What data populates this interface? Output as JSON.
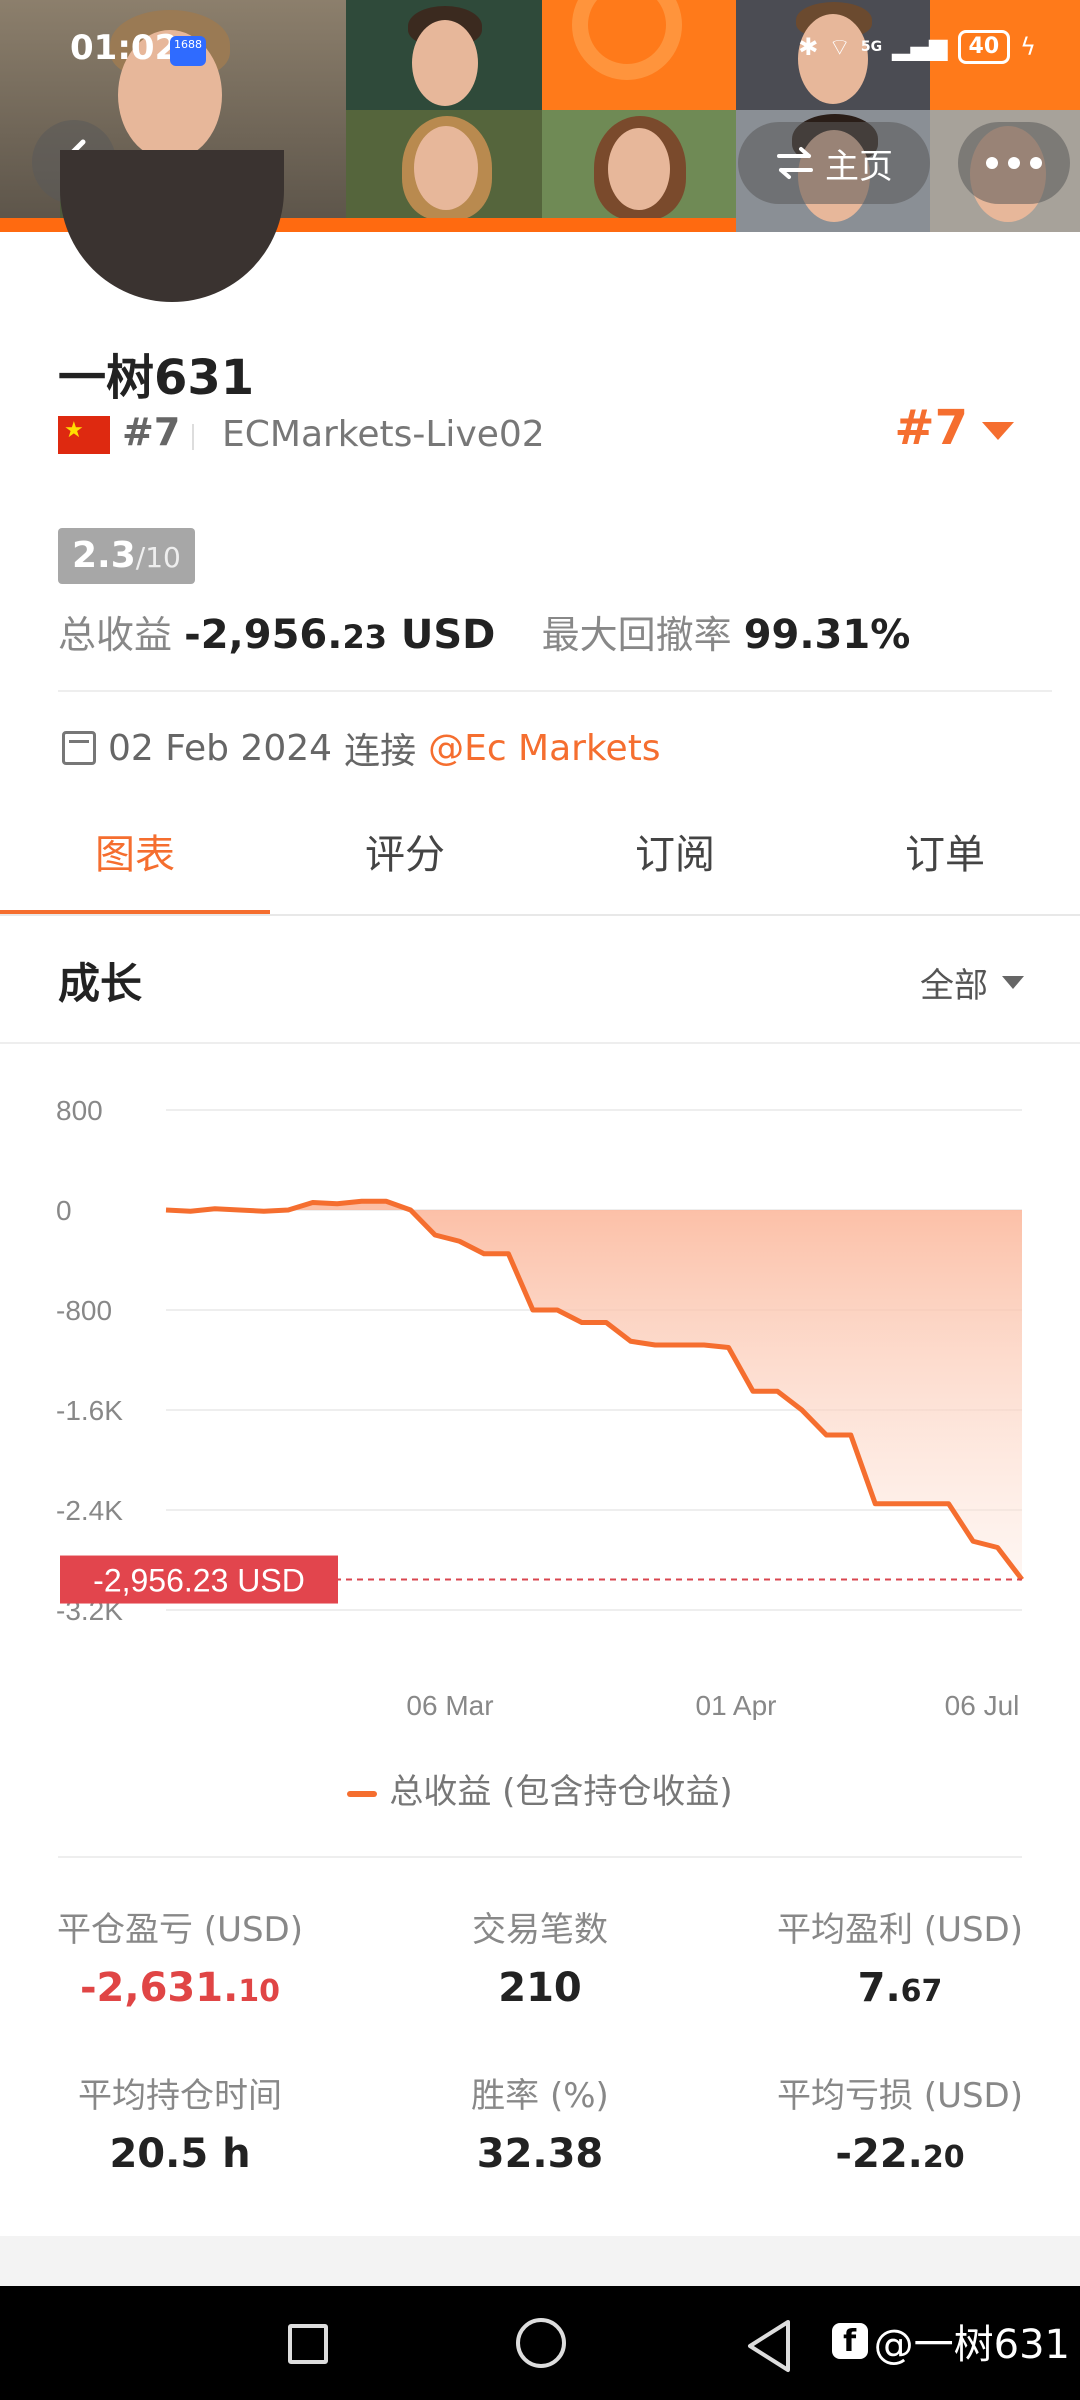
{
  "status_bar": {
    "time": "01:02",
    "app_badge": "1688",
    "signal": "5G",
    "battery": "40"
  },
  "header": {
    "home_label": "主页"
  },
  "profile": {
    "name": "一树631",
    "rank_small": "#7",
    "server": "ECMarkets-Live02",
    "rank_big": "#7",
    "score": "2.3",
    "score_max": "/10",
    "total_profit_label": "总收益",
    "total_profit_main": "-2,956.",
    "total_profit_cents": "23",
    "total_profit_unit": " USD",
    "max_drawdown_label": "最大回撤率",
    "max_drawdown_value": "99.31%",
    "connect_date": "02 Feb 2024",
    "connect_label": "连接",
    "broker": "@Ec Markets"
  },
  "tabs": [
    "图表",
    "评分",
    "订阅",
    "订单"
  ],
  "section": {
    "title": "成长",
    "range": "全部"
  },
  "chart_data": {
    "type": "area",
    "y_tick_labels": [
      "800",
      "0",
      "-800",
      "-1.6K",
      "-2.4K",
      "-3.2K"
    ],
    "y_tick_values": [
      800,
      0,
      -800,
      -1600,
      -2400,
      -3200
    ],
    "x_tick_labels": [
      "06 Mar",
      "01 Apr",
      "06 Jul"
    ],
    "ylim": [
      -3200,
      800
    ],
    "current_value_label": "-2,956.23 USD",
    "current_value": -2956.23,
    "series": [
      {
        "name": "总收益 (包含持仓收益)",
        "y": [
          0,
          -10,
          10,
          0,
          -10,
          0,
          60,
          50,
          70,
          70,
          0,
          -200,
          -250,
          -350,
          -350,
          -800,
          -800,
          -900,
          -900,
          -1050,
          -1080,
          -1080,
          -1080,
          -1100,
          -1450,
          -1450,
          -1600,
          -1800,
          -1800,
          -2350,
          -2350,
          -2350,
          -2350,
          -2650,
          -2700,
          -2956.23
        ]
      }
    ],
    "color": "#f56e2f",
    "fill_color": "#fbb79b",
    "grid": true
  },
  "legend_label": "总收益 (包含持仓收益)",
  "metrics": [
    {
      "label": "平仓盈亏 (USD)",
      "main": "-2,631.",
      "cents": "10",
      "negative": true
    },
    {
      "label": "交易笔数",
      "main": "210",
      "cents": "",
      "negative": false
    },
    {
      "label": "平均盈利 (USD)",
      "main": "7.",
      "cents": "67",
      "negative": false
    },
    {
      "label": "平均持仓时间",
      "main": "20.5 h",
      "cents": "",
      "negative": false
    },
    {
      "label": "胜率 (%)",
      "main": "32.38",
      "cents": "",
      "negative": false
    },
    {
      "label": "平均亏损 (USD)",
      "main": "-22.",
      "cents": "20",
      "negative": false
    }
  ],
  "watermark": "@一树631"
}
